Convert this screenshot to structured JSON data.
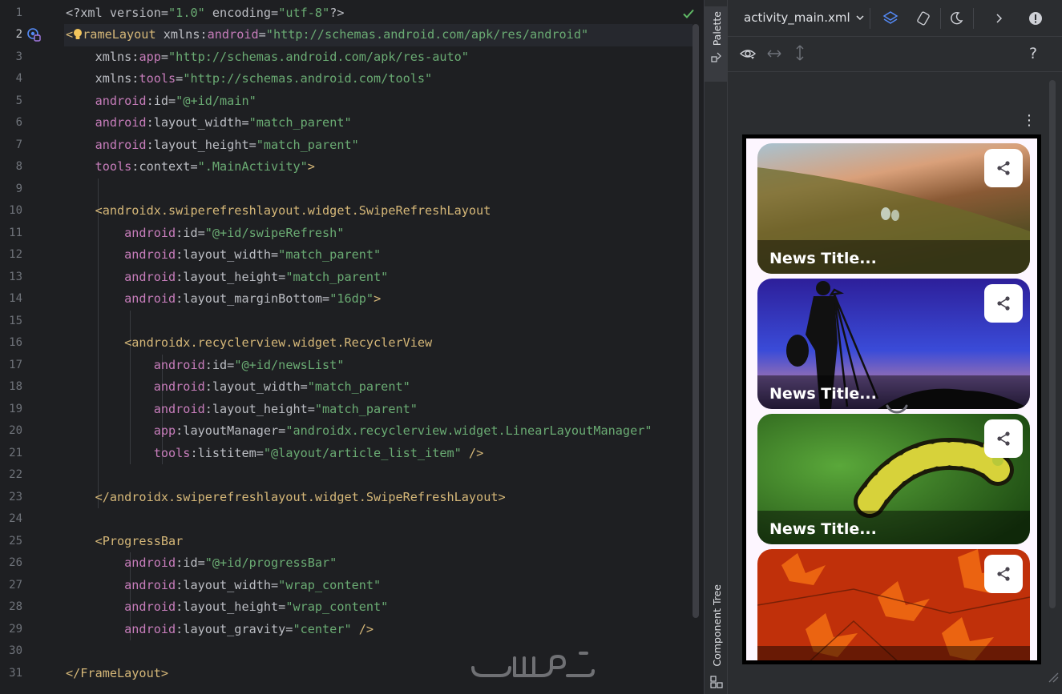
{
  "editor": {
    "line_numbers": [
      "1",
      "2",
      "3",
      "4",
      "5",
      "6",
      "7",
      "8",
      "9",
      "10",
      "11",
      "12",
      "13",
      "14",
      "15",
      "16",
      "17",
      "18",
      "19",
      "20",
      "21",
      "22",
      "23",
      "24",
      "25",
      "26",
      "27",
      "28",
      "29",
      "30",
      "31"
    ],
    "lines": [
      [
        {
          "c": "t-pi",
          "t": "<?xml "
        },
        {
          "c": "t-attr",
          "t": "version="
        },
        {
          "c": "t-str",
          "t": "\"1.0\" "
        },
        {
          "c": "t-attr",
          "t": "encoding="
        },
        {
          "c": "t-str",
          "t": "\"utf-8\""
        },
        {
          "c": "t-pi",
          "t": "?>"
        }
      ],
      [
        {
          "c": "t-tag",
          "t": "<"
        },
        {
          "c": "bulb",
          "t": ""
        },
        {
          "c": "t-tag",
          "t": "rameLayout "
        },
        {
          "c": "t-attr",
          "t": "xmlns:"
        },
        {
          "c": "t-ns",
          "t": "android"
        },
        {
          "c": "t-attr",
          "t": "="
        },
        {
          "c": "t-str",
          "t": "\"http://schemas.android.com/apk/res/android\""
        }
      ],
      [
        {
          "c": "t-attr",
          "t": "    xmlns:"
        },
        {
          "c": "t-ns",
          "t": "app"
        },
        {
          "c": "t-attr",
          "t": "="
        },
        {
          "c": "t-str",
          "t": "\"http://schemas.android.com/apk/res-auto\""
        }
      ],
      [
        {
          "c": "t-attr",
          "t": "    xmlns:"
        },
        {
          "c": "t-ns",
          "t": "tools"
        },
        {
          "c": "t-attr",
          "t": "="
        },
        {
          "c": "t-str",
          "t": "\"http://schemas.android.com/tools\""
        }
      ],
      [
        {
          "c": "t-ns",
          "t": "    android"
        },
        {
          "c": "t-attr",
          "t": ":id="
        },
        {
          "c": "t-str",
          "t": "\"@+id/main\""
        }
      ],
      [
        {
          "c": "t-ns",
          "t": "    android"
        },
        {
          "c": "t-attr",
          "t": ":layout_width="
        },
        {
          "c": "t-str",
          "t": "\"match_parent\""
        }
      ],
      [
        {
          "c": "t-ns",
          "t": "    android"
        },
        {
          "c": "t-attr",
          "t": ":layout_height="
        },
        {
          "c": "t-str",
          "t": "\"match_parent\""
        }
      ],
      [
        {
          "c": "t-ns",
          "t": "    tools"
        },
        {
          "c": "t-attr",
          "t": ":context="
        },
        {
          "c": "t-str",
          "t": "\".MainActivity\""
        },
        {
          "c": "t-tag",
          "t": ">"
        }
      ],
      [],
      [
        {
          "c": "t-tag",
          "t": "    <androidx.swiperefreshlayout.widget.SwipeRefreshLayout"
        }
      ],
      [
        {
          "c": "t-ns",
          "t": "        android"
        },
        {
          "c": "t-attr",
          "t": ":id="
        },
        {
          "c": "t-str",
          "t": "\"@+id/swipeRefresh\""
        }
      ],
      [
        {
          "c": "t-ns",
          "t": "        android"
        },
        {
          "c": "t-attr",
          "t": ":layout_width="
        },
        {
          "c": "t-str",
          "t": "\"match_parent\""
        }
      ],
      [
        {
          "c": "t-ns",
          "t": "        android"
        },
        {
          "c": "t-attr",
          "t": ":layout_height="
        },
        {
          "c": "t-str",
          "t": "\"match_parent\""
        }
      ],
      [
        {
          "c": "t-ns",
          "t": "        android"
        },
        {
          "c": "t-attr",
          "t": ":layout_marginBottom="
        },
        {
          "c": "t-str",
          "t": "\"16dp\""
        },
        {
          "c": "t-tag",
          "t": ">"
        }
      ],
      [],
      [
        {
          "c": "t-tag",
          "t": "        <androidx.recyclerview.widget.RecyclerView"
        }
      ],
      [
        {
          "c": "t-ns",
          "t": "            android"
        },
        {
          "c": "t-attr",
          "t": ":id="
        },
        {
          "c": "t-str",
          "t": "\"@+id/newsList\""
        }
      ],
      [
        {
          "c": "t-ns",
          "t": "            android"
        },
        {
          "c": "t-attr",
          "t": ":layout_width="
        },
        {
          "c": "t-str",
          "t": "\"match_parent\""
        }
      ],
      [
        {
          "c": "t-ns",
          "t": "            android"
        },
        {
          "c": "t-attr",
          "t": ":layout_height="
        },
        {
          "c": "t-str",
          "t": "\"match_parent\""
        }
      ],
      [
        {
          "c": "t-ns",
          "t": "            app"
        },
        {
          "c": "t-attr",
          "t": ":layoutManager="
        },
        {
          "c": "t-str",
          "t": "\"androidx.recyclerview.widget.LinearLayoutManager\""
        }
      ],
      [
        {
          "c": "t-ns",
          "t": "            tools"
        },
        {
          "c": "t-attr",
          "t": ":listitem="
        },
        {
          "c": "t-str",
          "t": "\"@layout/article_list_item\" "
        },
        {
          "c": "t-tag",
          "t": "/>"
        }
      ],
      [],
      [
        {
          "c": "t-tag",
          "t": "    </androidx.swiperefreshlayout.widget.SwipeRefreshLayout>"
        }
      ],
      [],
      [
        {
          "c": "t-tag",
          "t": "    <ProgressBar"
        }
      ],
      [
        {
          "c": "t-ns",
          "t": "        android"
        },
        {
          "c": "t-attr",
          "t": ":id="
        },
        {
          "c": "t-str",
          "t": "\"@+id/progressBar\""
        }
      ],
      [
        {
          "c": "t-ns",
          "t": "        android"
        },
        {
          "c": "t-attr",
          "t": ":layout_width="
        },
        {
          "c": "t-str",
          "t": "\"wrap_content\""
        }
      ],
      [
        {
          "c": "t-ns",
          "t": "        android"
        },
        {
          "c": "t-attr",
          "t": ":layout_height="
        },
        {
          "c": "t-str",
          "t": "\"wrap_content\""
        }
      ],
      [
        {
          "c": "t-ns",
          "t": "        android"
        },
        {
          "c": "t-attr",
          "t": ":layout_gravity="
        },
        {
          "c": "t-str",
          "t": "\"center\" "
        },
        {
          "c": "t-tag",
          "t": "/>"
        }
      ],
      [],
      [
        {
          "c": "t-tag",
          "t": "</FrameLayout>"
        }
      ]
    ]
  },
  "side_strip": {
    "palette_label": "Palette",
    "component_tree_label": "Component Tree"
  },
  "design": {
    "file_name": "activity_main.xml",
    "help_label": "?",
    "cards": [
      {
        "title": "News Title...",
        "image": "wood-droplets"
      },
      {
        "title": "News Title...",
        "image": "photographer-silhouette"
      },
      {
        "title": "News Title...",
        "image": "caterpillar"
      },
      {
        "title": "",
        "image": "red-leaves"
      }
    ]
  },
  "watermark": "خمسات",
  "colors": {
    "tag": "#d5b778",
    "namespace": "#c77dbb",
    "string": "#6aab73",
    "text": "#bcbec4",
    "background": "#1e1f22"
  }
}
